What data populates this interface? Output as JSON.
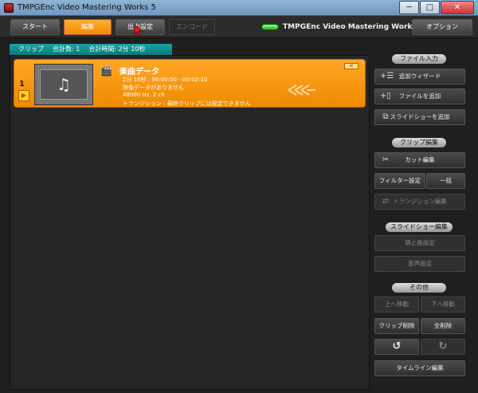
{
  "window": {
    "title": "TMPGEnc Video Mastering Works 5",
    "minimize": "─",
    "maximize": "□",
    "close": "✕"
  },
  "toolbar": {
    "start": "スタート",
    "edit": "編集",
    "output": "出力設定",
    "encode": "エンコード",
    "brand": "TMPGEnc Video Mastering Works 5",
    "options": "オプション"
  },
  "status": {
    "clip": "クリップ",
    "total_count": "合計数: 1",
    "total_time": "合計時間: 2分 10秒"
  },
  "clip": {
    "number": "1",
    "title": "楽曲データ",
    "duration": "2分 10秒 : 00:00:00 - 00:02:10",
    "video": "映像データがありません",
    "audio": "48000 Hz, 2 ch",
    "transition": "トランジション : 最終クリップには設定できません",
    "note_icon": "♫",
    "close": "✕"
  },
  "panel": {
    "file_input": "ファイル入力",
    "add_wizard": "追加ウィザード",
    "add_file": "ファイルを追加",
    "add_slideshow": "スライドショーを追加",
    "clip_edit": "クリップ編集",
    "cut_edit": "カット編集",
    "filter_settings": "フィルター設定",
    "batch": "一括",
    "transition_edit": "トランジション編集",
    "slideshow_edit": "スライドショー編集",
    "still_settings": "静止画設定",
    "audio_settings": "音声設定",
    "other": "その他",
    "move_up": "上へ移動",
    "move_down": "下へ移動",
    "clip_delete": "クリップ削除",
    "delete_all": "全削除",
    "timeline_edit": "タイムライン編集"
  }
}
